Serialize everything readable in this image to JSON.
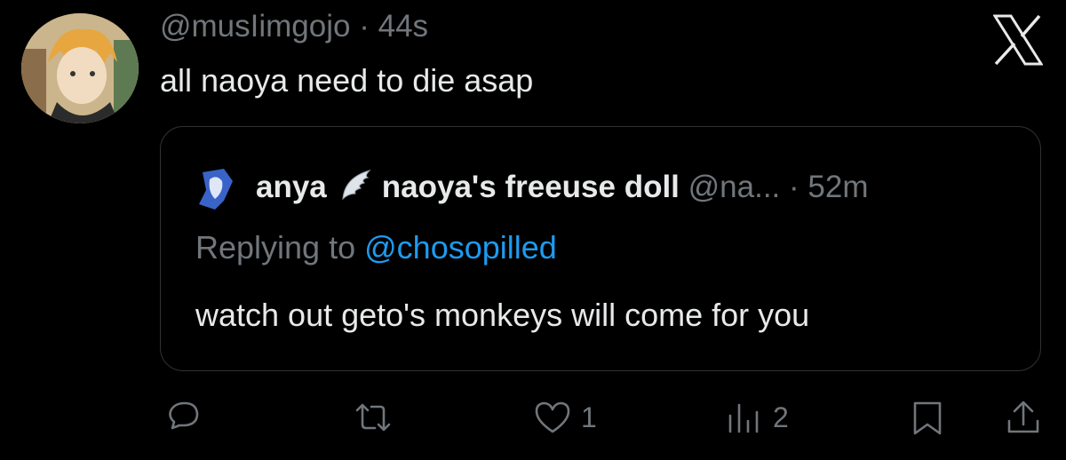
{
  "tweet": {
    "handle": "@musIimgojo",
    "separator": "·",
    "time": "44s",
    "text": "all naoya need to die asap"
  },
  "quoted": {
    "name_part1": "anya",
    "name_part2": "naoya's freeuse doll",
    "handle": "@na...",
    "separator": "·",
    "time": "52m",
    "reply_prefix": "Replying to",
    "reply_mention": "@chosopilled",
    "text": "watch out geto's monkeys will come for you"
  },
  "actions": {
    "reply_icon": "comment-icon",
    "retweet_icon": "retweet-icon",
    "like_icon": "heart-icon",
    "like_count": "1",
    "views_icon": "views-icon",
    "views_count": "2",
    "bookmark_icon": "bookmark-icon",
    "share_icon": "share-icon"
  },
  "colors": {
    "background": "#000000",
    "text": "#e7e9ea",
    "muted": "#71767b",
    "link": "#1d9bf0",
    "border": "#2f3336"
  }
}
